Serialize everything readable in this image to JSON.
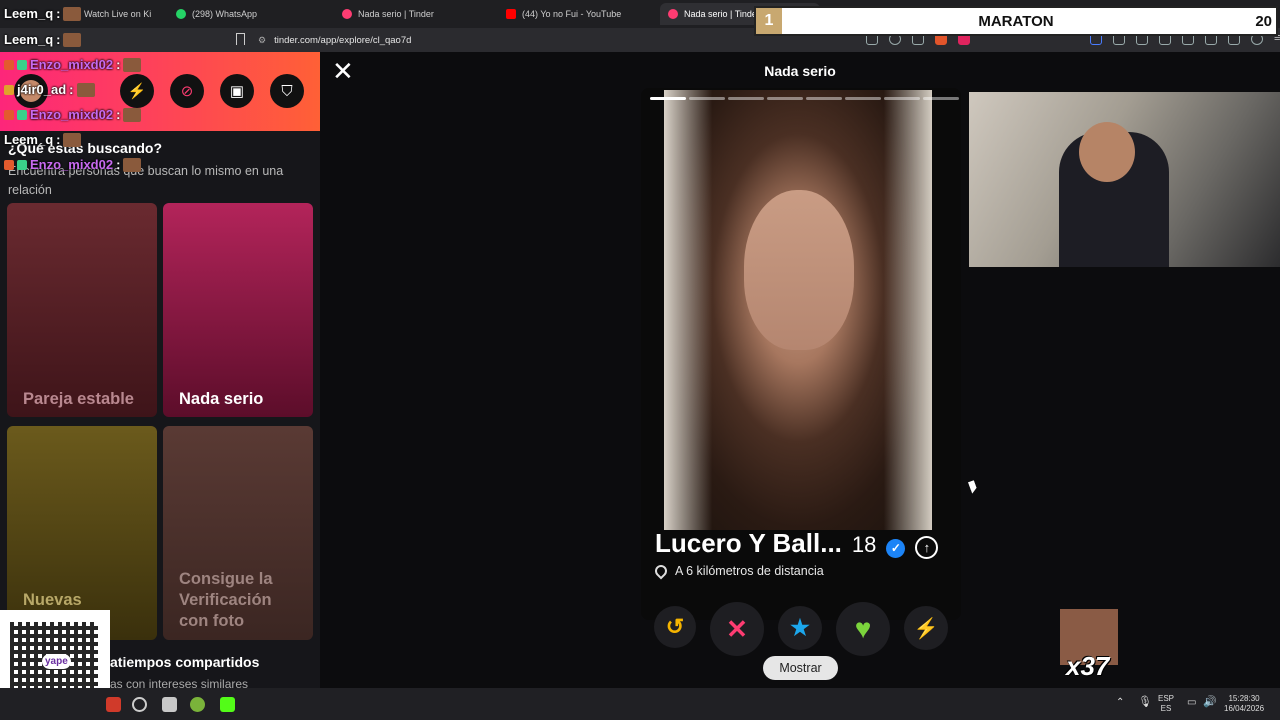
{
  "browser": {
    "tabs": [
      {
        "label": "Watch Live on Ki",
        "icon": "kick-icon",
        "color": "#53fc18",
        "active": false
      },
      {
        "label": "(298) WhatsApp",
        "icon": "whatsapp-icon",
        "color": "#25d366",
        "active": false
      },
      {
        "label": "Nada serio | Tinder",
        "icon": "tinder-icon",
        "color": "#fe3c72",
        "active": false
      },
      {
        "label": "(44) Yo no Fui - YouTube",
        "icon": "youtube-icon",
        "color": "#ff0000",
        "active": false
      },
      {
        "label": "Nada serio | Tinder",
        "icon": "tinder-icon",
        "color": "#fe3c72",
        "active": true
      }
    ],
    "new_tab": "+",
    "close_tab": "×",
    "url": "tinder.com/app/explore/cl_qao7d"
  },
  "overlay": {
    "maraton_left": "1",
    "maraton_title": "MARATON",
    "maraton_right": "20"
  },
  "chat": [
    {
      "user": "Leem_q",
      "sep": ":",
      "color": "#ffffff"
    },
    {
      "user": "Leem_q",
      "sep": ":",
      "color": "#ffffff"
    },
    {
      "user": "Enzo_mixd02",
      "sep": ":",
      "color": "#c86af0"
    },
    {
      "user": "j4ir0_ad",
      "sep": ":",
      "color": "#ffffff"
    },
    {
      "user": "Enzo_mixd02",
      "sep": ":",
      "color": "#c86af0"
    },
    {
      "user": "Leem_q",
      "sep": ":",
      "color": "#ffffff"
    },
    {
      "user": "Enzo_mixd02",
      "sep": ":",
      "color": "#c86af0"
    }
  ],
  "sidebar": {
    "title": "¿Qué estás buscando?",
    "subtitle": "Encuentra personas que buscan lo mismo en una relación",
    "cards": [
      {
        "label": "Pareja estable",
        "color": "#5a1f27"
      },
      {
        "label": "Nada serio",
        "color": "#7a1036"
      },
      {
        "label": "Nuevas",
        "color": "#5d4a14"
      },
      {
        "label": "Consigue la Verificación con foto",
        "color": "#4a2f2a"
      }
    ],
    "bottom_title": "atiempos compartidos",
    "bottom_sub": "as con intereses similares"
  },
  "main": {
    "close": "✕",
    "title": "Nada serio",
    "profile": {
      "name": "Lucero Y Ball...",
      "age": "18",
      "distance": "A 6 kilómetros de distancia",
      "photo_count": 8,
      "active_photo": 1
    },
    "actions": [
      {
        "name": "rewind-button",
        "glyph": "↺",
        "color": "#f5b400"
      },
      {
        "name": "nope-button",
        "glyph": "✕",
        "color": "#fe3c72"
      },
      {
        "name": "superlike-button",
        "glyph": "★",
        "color": "#1ca7ec"
      },
      {
        "name": "like-button",
        "glyph": "♥",
        "color": "#7bd43c"
      },
      {
        "name": "boost-button",
        "glyph": "⚡",
        "color": "#a44bff"
      }
    ],
    "show_button": "Mostrar"
  },
  "qr": {
    "label": "yape"
  },
  "sticker": {
    "text": "x37"
  },
  "taskbar": {
    "lang_top": "ESP",
    "lang_bottom": "ES",
    "time": "15:28:30",
    "date": "16/04/2026"
  }
}
